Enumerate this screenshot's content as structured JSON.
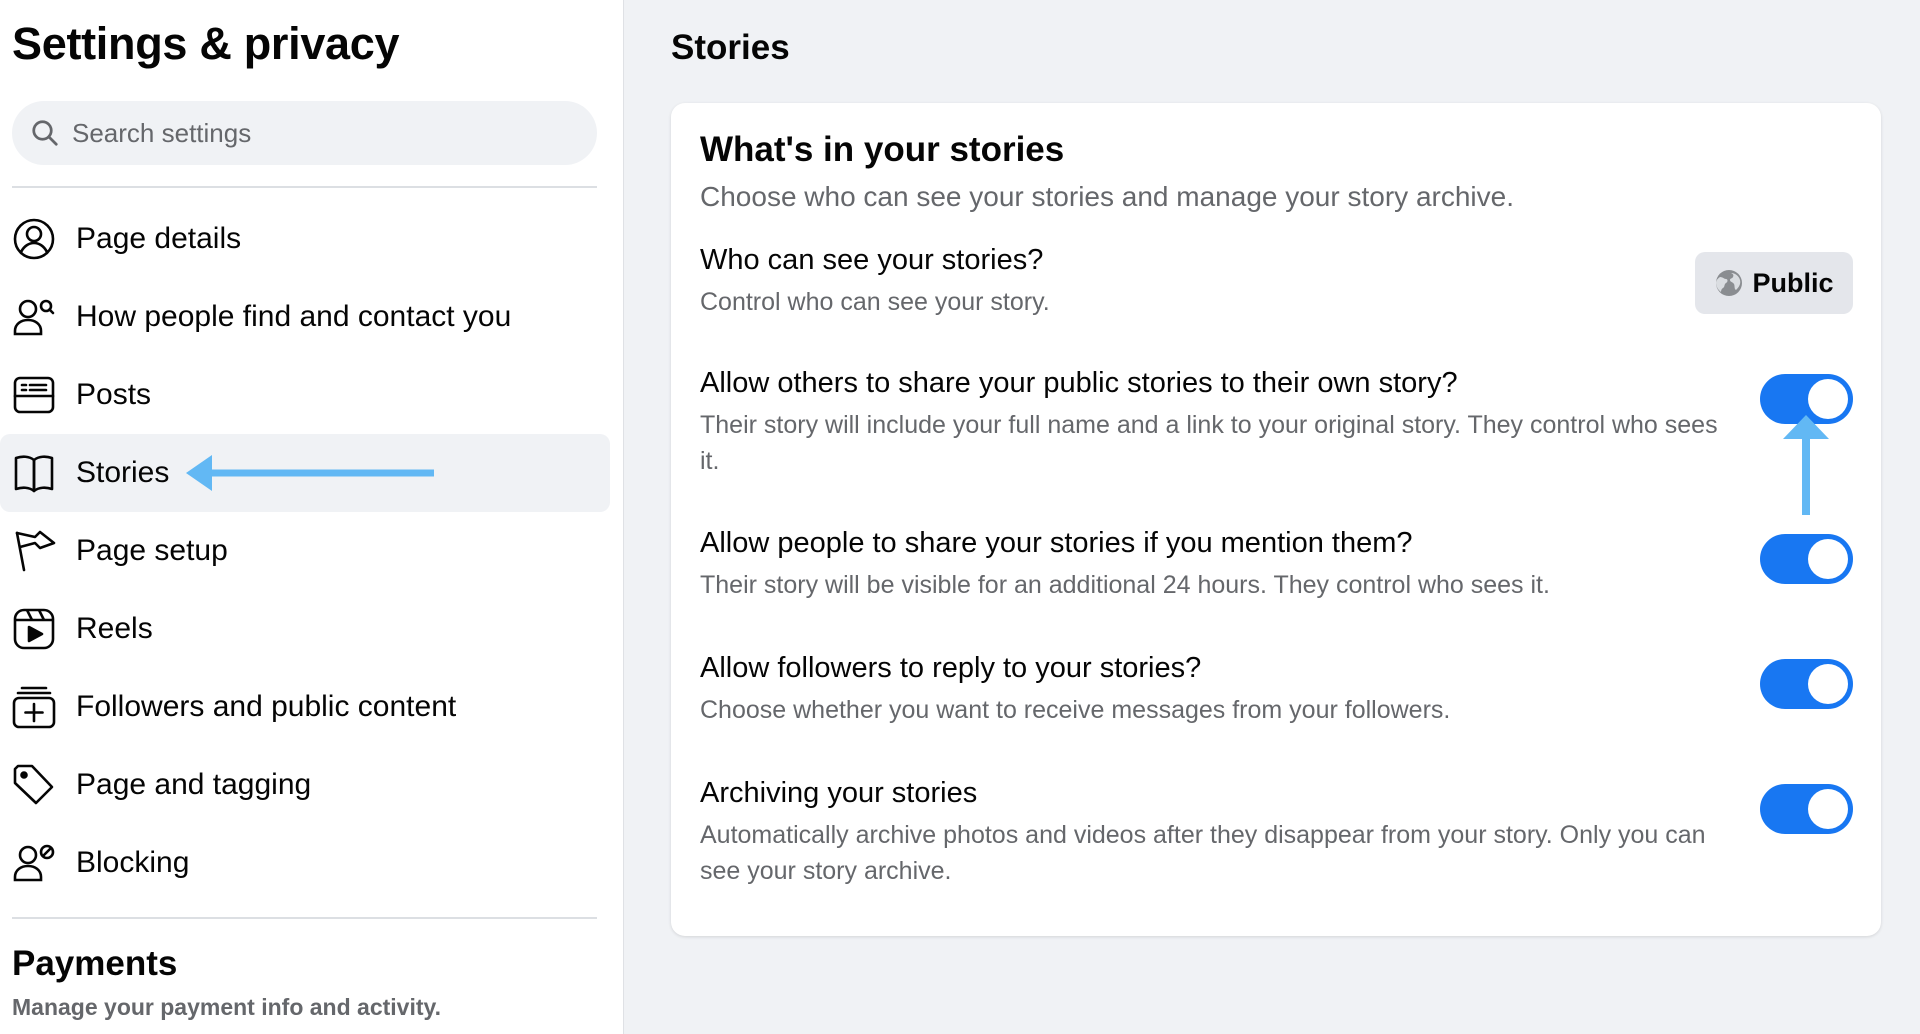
{
  "sidebar": {
    "title": "Settings & privacy",
    "search_placeholder": "Search settings",
    "items": [
      {
        "label": "Page details",
        "icon": "user-circle-icon"
      },
      {
        "label": "How people find and contact you",
        "icon": "user-search-icon"
      },
      {
        "label": "Posts",
        "icon": "posts-icon"
      },
      {
        "label": "Stories",
        "icon": "book-icon",
        "active": true
      },
      {
        "label": "Page setup",
        "icon": "flag-icon"
      },
      {
        "label": "Reels",
        "icon": "reels-icon"
      },
      {
        "label": "Followers and public content",
        "icon": "add-box-icon"
      },
      {
        "label": "Page and tagging",
        "icon": "tag-icon"
      },
      {
        "label": "Blocking",
        "icon": "user-block-icon"
      }
    ],
    "payments": {
      "title": "Payments",
      "subtitle": "Manage your payment info and activity."
    }
  },
  "main": {
    "title": "Stories",
    "card": {
      "heading": "What's in your stories",
      "subheading": "Choose who can see your stories and manage your story archive.",
      "audience": {
        "title": "Who can see your stories?",
        "description": "Control who can see your story.",
        "button_label": "Public"
      },
      "settings": [
        {
          "title": "Allow others to share your public stories to their own story?",
          "description": "Their story will include your full name and a link to your original story. They control who sees it.",
          "enabled": true
        },
        {
          "title": "Allow people to share your stories if you mention them?",
          "description": "Their story will be visible for an additional 24 hours. They control who sees it.",
          "enabled": true
        },
        {
          "title": "Allow followers to reply to your stories?",
          "description": "Choose whether you want to receive messages from your followers.",
          "enabled": true
        },
        {
          "title": "Archiving your stories",
          "description": "Automatically archive photos and videos after they disappear from your story. Only you can see your story archive.",
          "enabled": true
        }
      ]
    }
  },
  "colors": {
    "accent": "#1877f2",
    "annotation_arrow": "#62b8f4",
    "background": "#f0f2f5",
    "secondary_text": "#65676b"
  }
}
